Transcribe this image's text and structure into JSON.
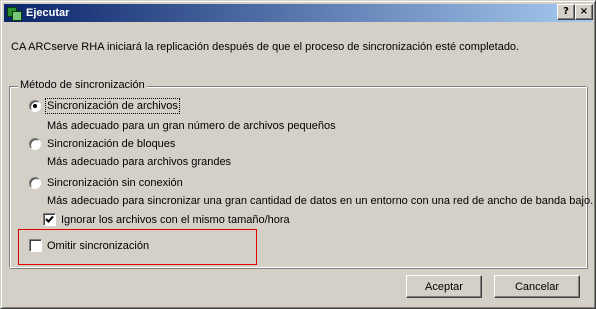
{
  "window": {
    "title": "Ejecutar",
    "help_label": "?",
    "close_label": "×"
  },
  "message": "CA ARCserve RHA iniciará la replicación después de que el proceso de sincronización esté completado.",
  "sync_group": {
    "legend": "Método de sincronización",
    "options": [
      {
        "label": "Sincronización de archivos",
        "description": "Más adecuado para un gran número de archivos pequeños",
        "selected": true
      },
      {
        "label": "Sincronización de bloques",
        "description": "Más adecuado para archivos grandes",
        "selected": false
      },
      {
        "label": "Sincronización sin conexión",
        "description": "Más adecuado para sincronizar una gran cantidad de datos en un entorno con una red de ancho de banda bajo.",
        "selected": false
      }
    ],
    "ignore_same_files": {
      "label": "Ignorar los archivos con el mismo tamaño/hora",
      "checked": true
    },
    "skip_sync": {
      "label": "Omitir sincronización",
      "checked": false
    }
  },
  "buttons": {
    "ok": "Aceptar",
    "cancel": "Cancelar"
  },
  "colors": {
    "title_gradient_start": "#0a246a",
    "title_gradient_end": "#a6caf0",
    "dialog_bg": "#d4d0c8",
    "highlight_border": "#e00000"
  }
}
